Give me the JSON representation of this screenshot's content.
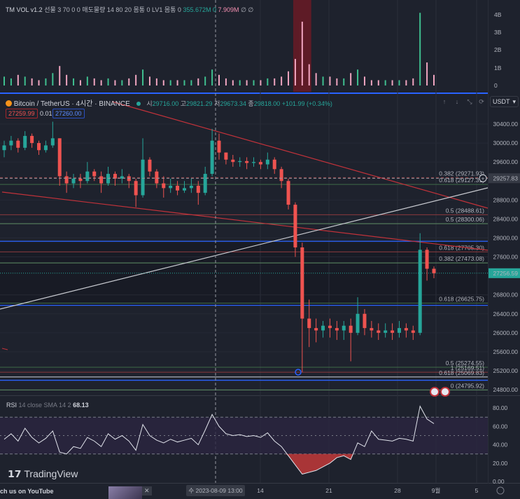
{
  "volume_indicator": {
    "name": "TM VOL v1.2",
    "params": "선물 3 70 0 0 매도물량 14 80 20 몸통 0 LV1 몸통 0",
    "value_green": "355.672M",
    "value_zero": "0",
    "value_pink": "7.909M",
    "tail": "∅ ∅",
    "axis_ticks": [
      "4B",
      "3B",
      "2B",
      "1B",
      "0"
    ]
  },
  "symbol": {
    "title": "Bitcoin / TetherUS · 4시간 · BINANCE",
    "ohlc": [
      {
        "label": "시",
        "value": "29716.00"
      },
      {
        "label": "고",
        "value": "29821.29"
      },
      {
        "label": "저",
        "value": "29673.34"
      },
      {
        "label": "종",
        "value": "29818.00"
      }
    ],
    "change": "+101.99 (+0.34%)",
    "sell_price": "27259.99",
    "spread": "0.01",
    "buy_price": "27260.00",
    "currency": "USDT",
    "colors": {
      "up": "#26a69a",
      "down": "#ef5350",
      "accent": "#2962ff"
    }
  },
  "price_axis": {
    "ticks": [
      "30400.00",
      "30000.00",
      "29600.00",
      "28800.00",
      "28400.00",
      "28000.00",
      "27600.00",
      "26800.00",
      "26400.00",
      "26000.00",
      "25600.00",
      "25200.00",
      "24800.00"
    ],
    "crosshair_label": "29257.83",
    "last_price": "27256.59"
  },
  "fib_labels": [
    {
      "text": "0.382 (29271.93)",
      "color": "#8b3a3e",
      "price": 29271.93
    },
    {
      "text": "0.618 (29127.31)",
      "color": "#3f6b48",
      "price": 29127.31
    },
    {
      "text": "0.5 (28488.61)",
      "color": "#8b3a3e",
      "price": 28488.61
    },
    {
      "text": "0.5 (28300.06)",
      "color": "#5f8f66",
      "price": 28300.06
    },
    {
      "text": "0.618 (27705.30)",
      "color": "#8b3a3e",
      "price": 27705.3
    },
    {
      "text": "0.382 (27473.08)",
      "color": "#5f8f66",
      "price": 27473.08
    },
    {
      "text": "0.618 (26625.75)",
      "color": "#3f6b48",
      "price": 26625.75
    },
    {
      "text": "0.5 (25274.55)",
      "color": "#3f6b48",
      "price": 25274.55
    },
    {
      "text": "1 (25169.51)",
      "color": "#8b3a3e",
      "price": 25169.51
    },
    {
      "text": "0.618 (25069.83)",
      "color": "#d1d4dc",
      "price": 25069.83
    },
    {
      "text": "0 (24795.92)",
      "color": "#5f8f66",
      "price": 24795.92
    }
  ],
  "rsi": {
    "label": "RSI",
    "params": "14 close SMA 14 2",
    "value": "68.13",
    "axis_ticks": [
      "80.00",
      "60.00",
      "40.00",
      "20.00",
      "0.00"
    ]
  },
  "time_axis": {
    "crosshair_label": "수 2023-08-09  13:00",
    "ticks": [
      "14",
      "21",
      "28",
      "9월",
      "5"
    ]
  },
  "branding": {
    "logo": "TradingView"
  },
  "popup": {
    "text": "ch us on YouTube",
    "close": "✕"
  },
  "chart_data": {
    "type": "candlestick",
    "title": "Bitcoin / TetherUS · 4시간 · BINANCE",
    "ylim": [
      24700,
      30600
    ],
    "open": [
      29850,
      29950,
      30050,
      29900,
      30150,
      30000,
      29850,
      29950,
      30100,
      29300,
      29150,
      29250,
      29200,
      29400,
      29300,
      29150,
      29350,
      29250,
      29300,
      29200,
      28900,
      29650,
      29400,
      29150,
      29050,
      29100,
      29000,
      29050,
      29100,
      28950,
      29350,
      30050,
      29800,
      29650,
      29600,
      29620,
      29580,
      29600,
      29550,
      29650,
      29450,
      29200,
      28700,
      27800,
      26300,
      26100,
      26050,
      26150,
      26100,
      26050,
      26150,
      26000,
      26400,
      26100,
      26050,
      26000,
      26050,
      26000,
      26100,
      26050,
      26000,
      27750,
      27350
    ],
    "close": [
      29950,
      30050,
      29900,
      30150,
      30000,
      29850,
      29950,
      30100,
      29300,
      29150,
      29250,
      29200,
      29400,
      29300,
      29150,
      29350,
      29250,
      29300,
      29200,
      28900,
      29650,
      29400,
      29150,
      29050,
      29100,
      29000,
      29050,
      29100,
      28950,
      29350,
      30050,
      29800,
      29650,
      29600,
      29620,
      29580,
      29600,
      29550,
      29650,
      29450,
      29200,
      28700,
      27800,
      26300,
      26100,
      26050,
      26150,
      26100,
      26050,
      26150,
      26000,
      26400,
      26100,
      26050,
      26000,
      26050,
      26000,
      26100,
      26050,
      26000,
      27750,
      27350,
      27257
    ],
    "high": [
      30050,
      30150,
      30100,
      30250,
      30200,
      30050,
      30050,
      30450,
      30100,
      29400,
      29350,
      29350,
      29600,
      29450,
      29400,
      29500,
      29400,
      29450,
      29350,
      29250,
      30100,
      29700,
      29450,
      29300,
      29250,
      29200,
      29200,
      29250,
      29200,
      29500,
      30300,
      30200,
      29800,
      29750,
      29700,
      29700,
      29700,
      29650,
      29800,
      29700,
      29500,
      29250,
      28750,
      27900,
      26700,
      26300,
      26250,
      26300,
      26250,
      26250,
      26300,
      26750,
      26500,
      26250,
      26200,
      26200,
      26200,
      26250,
      26200,
      26150,
      28100,
      27800,
      27400
    ],
    "low": [
      29700,
      29850,
      29800,
      29850,
      29900,
      29750,
      29800,
      29900,
      29100,
      28950,
      29050,
      29050,
      29150,
      29200,
      28950,
      29100,
      29100,
      29150,
      29050,
      28650,
      28850,
      29300,
      29050,
      28850,
      28950,
      28900,
      28950,
      28950,
      28700,
      28900,
      29300,
      29650,
      29550,
      29500,
      29500,
      29450,
      29500,
      29450,
      29450,
      29350,
      29050,
      28600,
      27600,
      25170,
      25700,
      25800,
      25900,
      25900,
      25850,
      25850,
      25400,
      25950,
      25950,
      25900,
      25850,
      25900,
      25850,
      25900,
      25900,
      25850,
      25950,
      27100,
      27150
    ],
    "volume_B": [
      0.5,
      0.4,
      0.6,
      0.5,
      0.4,
      0.3,
      0.4,
      0.7,
      1.1,
      0.6,
      0.4,
      0.3,
      0.5,
      0.4,
      0.3,
      0.4,
      0.3,
      0.3,
      0.4,
      0.6,
      0.9,
      0.5,
      0.4,
      0.3,
      0.3,
      0.3,
      0.3,
      0.3,
      0.4,
      0.5,
      0.9,
      0.6,
      0.4,
      0.3,
      0.3,
      0.3,
      0.3,
      0.3,
      0.4,
      0.4,
      0.5,
      0.8,
      1.5,
      3.6,
      1.2,
      0.7,
      0.5,
      0.5,
      0.4,
      0.4,
      0.7,
      0.9,
      0.5,
      0.3,
      0.3,
      0.3,
      0.3,
      0.3,
      0.3,
      0.4,
      4.1,
      1.3,
      0.6
    ],
    "rsi": [
      46,
      52,
      44,
      58,
      48,
      42,
      47,
      55,
      32,
      30,
      38,
      36,
      48,
      44,
      38,
      52,
      46,
      50,
      44,
      34,
      62,
      50,
      45,
      42,
      46,
      43,
      45,
      47,
      40,
      56,
      73,
      60,
      52,
      50,
      51,
      49,
      50,
      48,
      53,
      44,
      38,
      28,
      18,
      8,
      10,
      12,
      16,
      20,
      26,
      28,
      24,
      42,
      38,
      55,
      46,
      45,
      44,
      47,
      46,
      44,
      82,
      68,
      63
    ],
    "rsi_ylim": [
      0,
      90
    ]
  }
}
